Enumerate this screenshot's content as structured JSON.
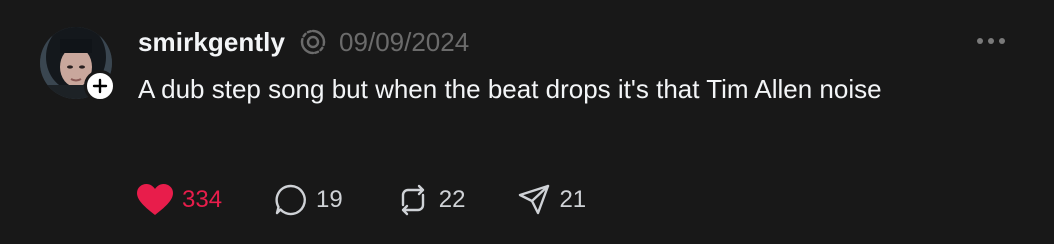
{
  "post": {
    "username": "smirkgently",
    "timestamp": "09/09/2024",
    "text": "A dub step song but when the beat drops it's that Tim Allen noise",
    "icons": {
      "avatar": "profile-photo",
      "follow": "plus-icon",
      "status": "spinner-icon",
      "more": "more-icon"
    }
  },
  "actions": {
    "likes": "334",
    "replies": "19",
    "reposts": "22",
    "shares": "21"
  },
  "colors": {
    "background": "#181818",
    "text": "#f3f5f7",
    "muted": "#6b6b6b",
    "like": "#e81d4b"
  }
}
